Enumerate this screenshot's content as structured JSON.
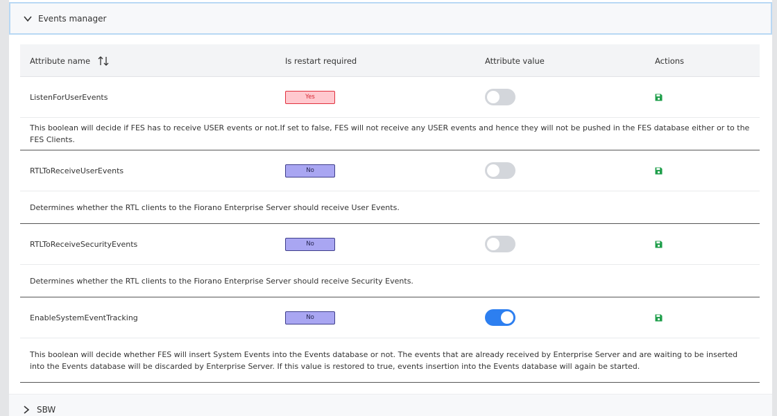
{
  "panel": {
    "title": "Events manager"
  },
  "table": {
    "headers": {
      "attribute_name": "Attribute name",
      "restart": "Is restart required",
      "value": "Attribute value",
      "actions": "Actions"
    },
    "rows": [
      {
        "name": "ListenForUserEvents",
        "restart": "Yes",
        "enabled": false,
        "description": "This boolean will decide if FES has to receive USER events or not.If set to false, FES will not receive any USER events and hence they will not be pushed in the FES database either or to the FES Clients."
      },
      {
        "name": "RTLToReceiveUserEvents",
        "restart": "No",
        "enabled": false,
        "description": "Determines whether the RTL clients to the Fiorano Enterprise Server should receive User Events."
      },
      {
        "name": "RTLToReceiveSecurityEvents",
        "restart": "No",
        "enabled": false,
        "description": "Determines whether the RTL clients to the Fiorano Enterprise Server should receive Security Events."
      },
      {
        "name": "EnableSystemEventTracking",
        "restart": "No",
        "enabled": true,
        "description": "This boolean will decide whether FES will insert System Events into the Events database or not. The events that are already received by Enterprise Server and are waiting to be inserted into the Events database will be discarded by Enterprise Server. If this value is restored to true, events insertion into the Events database will again be started."
      }
    ]
  },
  "next_panel": {
    "title": "SBW"
  },
  "colors": {
    "toggle_on": "#2d7ff0",
    "badge_yes_bg": "#ffc9cf",
    "badge_no_bg": "#a9a6f2",
    "save_icon": "#1e9e4a"
  }
}
